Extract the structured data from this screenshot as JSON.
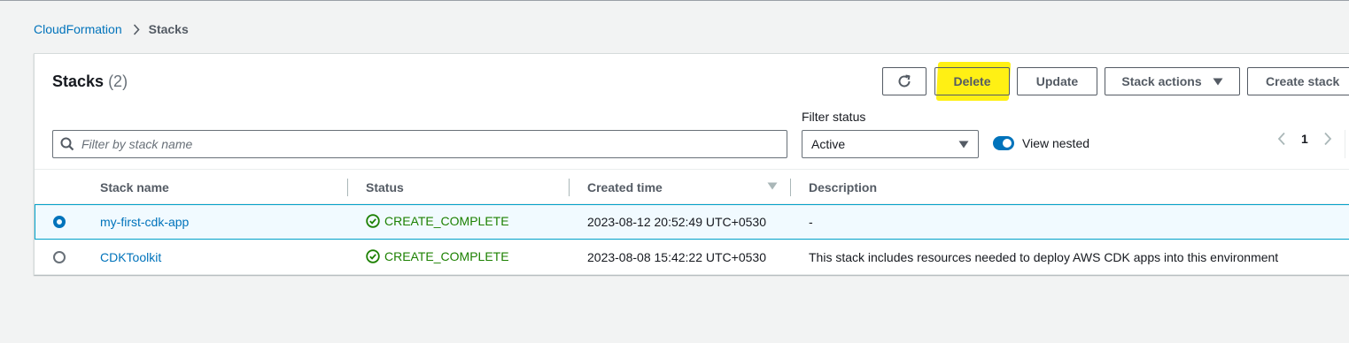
{
  "breadcrumb": {
    "root": "CloudFormation",
    "current": "Stacks"
  },
  "panel": {
    "title": "Stacks",
    "count": "(2)"
  },
  "toolbar": {
    "delete_label": "Delete",
    "update_label": "Update",
    "actions_label": "Stack actions",
    "create_label": "Create stack"
  },
  "search": {
    "placeholder": "Filter by stack name"
  },
  "filter": {
    "label": "Filter status",
    "value": "Active"
  },
  "toggle": {
    "label": "View nested",
    "enabled": true
  },
  "pager": {
    "page": "1"
  },
  "table": {
    "columns": [
      "Stack name",
      "Status",
      "Created time",
      "Description"
    ],
    "rows": [
      {
        "name": "my-first-cdk-app",
        "status": "CREATE_COMPLETE",
        "created": "2023-08-12 20:52:49 UTC+0530",
        "description": "-",
        "selected": true
      },
      {
        "name": "CDKToolkit",
        "status": "CREATE_COMPLETE",
        "created": "2023-08-08 15:42:22 UTC+0530",
        "description": "This stack includes resources needed to deploy AWS CDK apps into this environment",
        "selected": false
      }
    ]
  },
  "colors": {
    "link": "#0073bb",
    "success": "#1d8102",
    "highlight": "#ffef00"
  }
}
